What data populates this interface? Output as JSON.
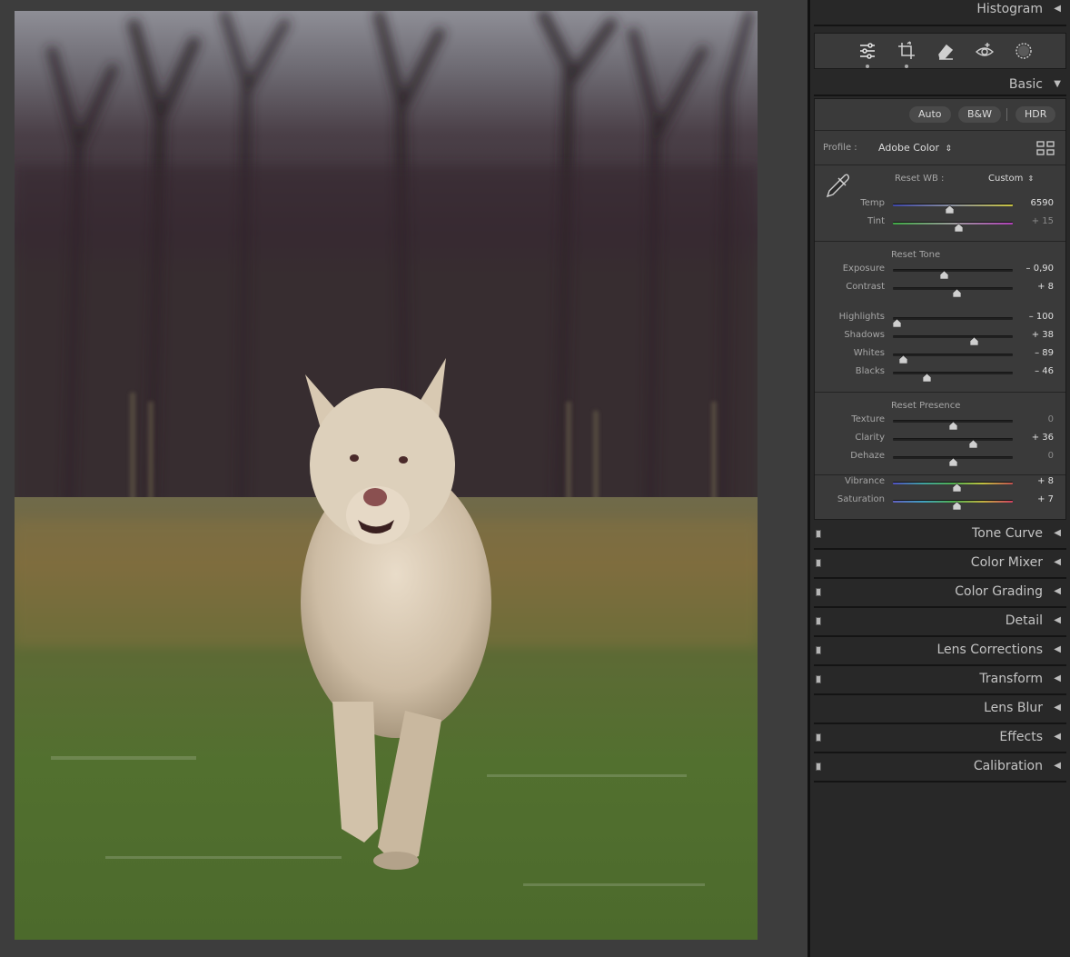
{
  "panel": {
    "histogram": {
      "title": "Histogram",
      "arrow": "◀"
    },
    "tools": [
      {
        "name": "edit-sliders-icon",
        "active": true
      },
      {
        "name": "crop-icon",
        "active": false
      },
      {
        "name": "eraser-icon",
        "active": false
      },
      {
        "name": "red-eye-icon",
        "active": false
      },
      {
        "name": "masking-icon",
        "active": false
      }
    ],
    "basic": {
      "title": "Basic",
      "arrow": "▼",
      "buttons": {
        "auto": "Auto",
        "bw": "B&W",
        "hdr": "HDR"
      },
      "profile": {
        "label": "Profile :",
        "value": "Adobe Color",
        "chevron": "⇕"
      },
      "wb": {
        "reset_label": "Reset WB :",
        "preset": "Custom",
        "chevron": "⇕"
      },
      "tone_reset": "Reset Tone",
      "presence_reset": "Reset Presence",
      "sliders": {
        "temp": {
          "label": "Temp",
          "value": "6590",
          "position": 0.47
        },
        "tint": {
          "label": "Tint",
          "value": "+ 15",
          "position": 0.55
        },
        "exposure": {
          "label": "Exposure",
          "value": "– 0,90",
          "position": 0.42
        },
        "contrast": {
          "label": "Contrast",
          "value": "+ 8",
          "position": 0.54
        },
        "highlights": {
          "label": "Highlights",
          "value": "– 100",
          "position": 0.0
        },
        "shadows": {
          "label": "Shadows",
          "value": "+ 38",
          "position": 0.69
        },
        "whites": {
          "label": "Whites",
          "value": "– 89",
          "position": 0.06
        },
        "blacks": {
          "label": "Blacks",
          "value": "– 46",
          "position": 0.27
        },
        "texture": {
          "label": "Texture",
          "value": "0",
          "position": 0.5
        },
        "clarity": {
          "label": "Clarity",
          "value": "+ 36",
          "position": 0.68
        },
        "dehaze": {
          "label": "Dehaze",
          "value": "0",
          "position": 0.5
        },
        "vibrance": {
          "label": "Vibrance",
          "value": "+ 8",
          "position": 0.54
        },
        "saturation": {
          "label": "Saturation",
          "value": "+ 7",
          "position": 0.535
        }
      }
    },
    "collapsed_sections": [
      {
        "name": "tone-curve",
        "title": "Tone Curve",
        "switch": true
      },
      {
        "name": "color-mixer",
        "title": "Color Mixer",
        "switch": true
      },
      {
        "name": "color-grading",
        "title": "Color Grading",
        "switch": true
      },
      {
        "name": "detail",
        "title": "Detail",
        "switch": true
      },
      {
        "name": "lens-corrections",
        "title": "Lens Corrections",
        "switch": true
      },
      {
        "name": "transform",
        "title": "Transform",
        "switch": true
      },
      {
        "name": "lens-blur",
        "title": "Lens Blur",
        "switch": false
      },
      {
        "name": "effects",
        "title": "Effects",
        "switch": true
      },
      {
        "name": "calibration",
        "title": "Calibration",
        "switch": true
      }
    ],
    "collapse_arrow": "◀"
  },
  "colors": {
    "panel_bg": "#282828",
    "section_bg": "#3a3a3a",
    "canvas_bg": "#3d3d3d"
  }
}
